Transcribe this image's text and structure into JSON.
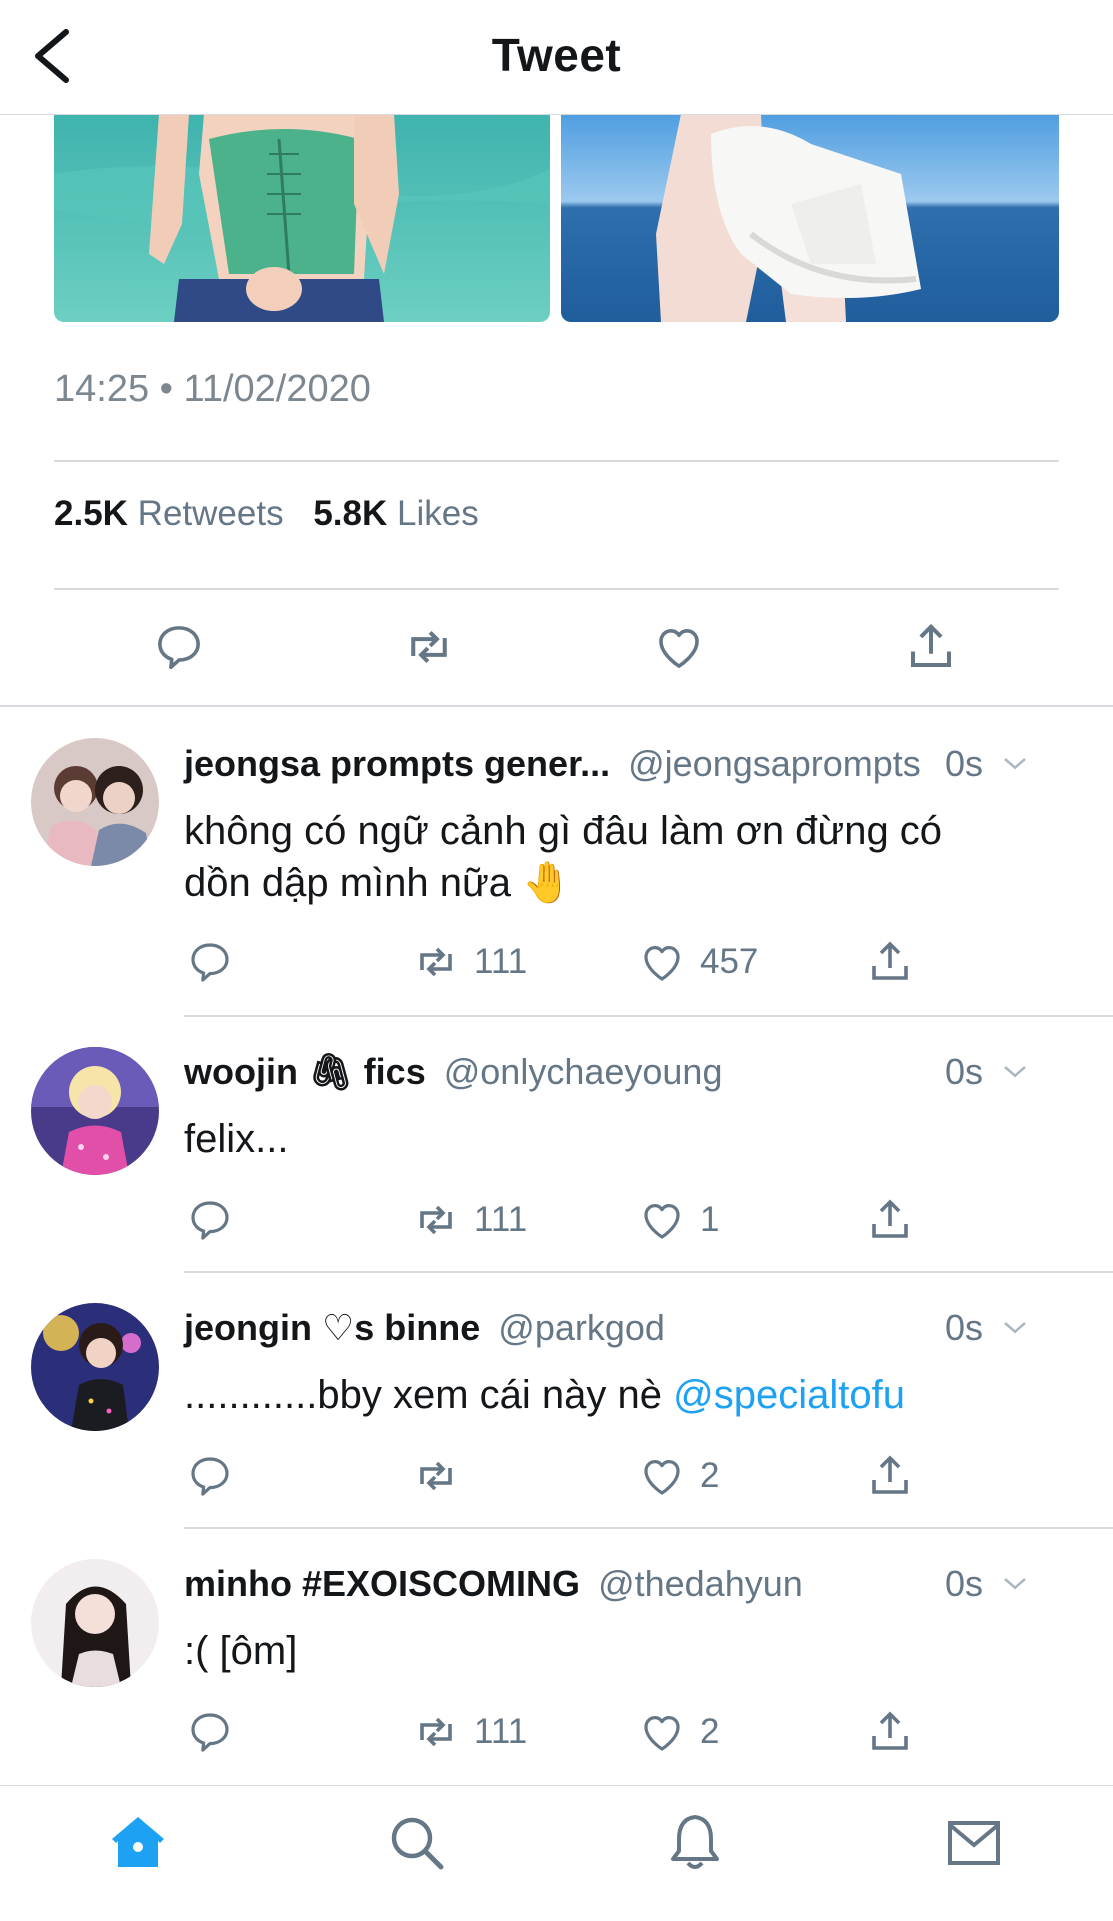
{
  "header": {
    "title": "Tweet"
  },
  "tweet": {
    "timestamp": "14:25 • 11/02/2020",
    "retweets_count": "2.5K",
    "retweets_label": "Retweets",
    "likes_count": "5.8K",
    "likes_label": "Likes"
  },
  "replies": [
    {
      "name": "jeongsa prompts gener...",
      "handle": "@jeongsaprompts",
      "time": "0s",
      "text_line1": "không có ngữ cảnh gì đâu làm ơn đừng có",
      "text_line2": "dồn dập mình nữa 🤚",
      "retweets": "111",
      "likes": "457"
    },
    {
      "name": "woojin 🖇 fics",
      "handle": "@onlychaeyoung",
      "time": "0s",
      "text": "felix...",
      "retweets": "111",
      "likes": "1"
    },
    {
      "name": "jeongin ♡s binne",
      "handle": "@parkgod",
      "time": "0s",
      "text": "............bby xem cái này nè",
      "mention": "@specialtofu",
      "retweets": "",
      "likes": "2"
    },
    {
      "name": "minho #EXOISCOMING",
      "handle": "@thedahyun",
      "time": "0s",
      "text": ":( [ôm]",
      "retweets": "111",
      "likes": "2"
    }
  ],
  "icons": {
    "back": "chevron-left-icon",
    "reply": "speech-bubble-icon",
    "retweet": "retweet-arrows-icon",
    "like": "heart-outline-icon",
    "share": "share-upload-icon",
    "tab_home": "home-icon",
    "tab_search": "search-icon",
    "tab_notifications": "bell-icon",
    "tab_messages": "envelope-icon"
  },
  "colors": {
    "accent": "#1da1f2",
    "muted": "#657786",
    "text": "#14171a",
    "divider": "#d7dbdf"
  }
}
